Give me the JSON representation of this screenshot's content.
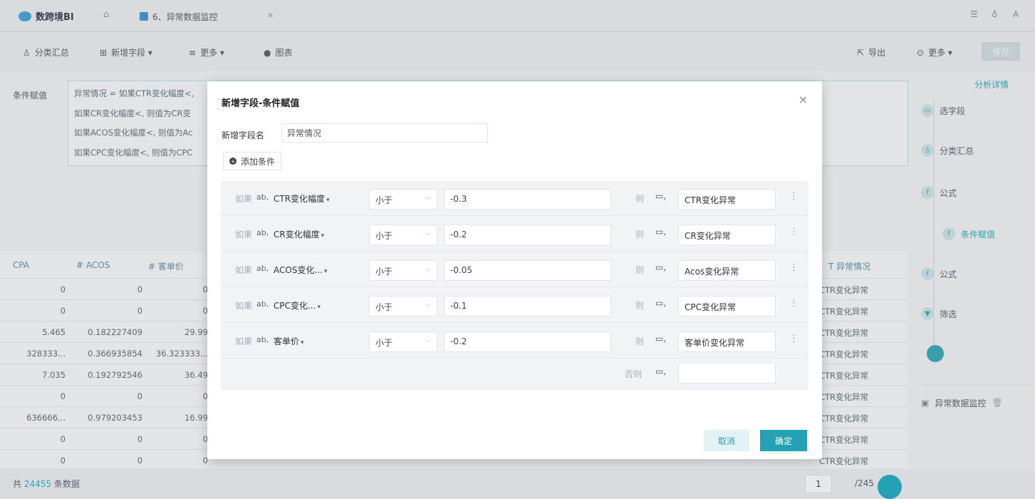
{
  "app": {
    "logo_text": "数跨境BI"
  },
  "tabs": [
    {
      "label": "6、异常数据监控"
    }
  ],
  "toolbar": {
    "items": [
      "分类汇总",
      "新增字段 ▾",
      "更多 ▾",
      "图表"
    ],
    "right_items": [
      "导出",
      "更多 ▾",
      "保存"
    ]
  },
  "background": {
    "cond_label": "条件赋值",
    "cond_lines": [
      "异常情况 = 如果CTR变化幅度<,",
      "如果CR变化幅度<, 则值为CR变",
      "如果ACOS变化幅度<, 则值为Ac",
      "如果CPC变化幅度<, 则值为CPC"
    ],
    "analysis_link": "分析详情",
    "table": {
      "headers": [
        "CPA",
        "# ACOS",
        "# 客单价",
        "T 异常情况"
      ],
      "rows": [
        [
          "0",
          "0",
          "0",
          "CTR变化异常"
        ],
        [
          "0",
          "0",
          "0",
          "CTR变化异常"
        ],
        [
          "5.465",
          "0.182227409",
          "29.99",
          "CTR变化异常"
        ],
        [
          "328333...",
          "0.366935854",
          "36.323333...",
          "CTR变化异常"
        ],
        [
          "7.035",
          "0.192792546",
          "36.49",
          "CTR变化异常"
        ],
        [
          "0",
          "0",
          "0",
          "CTR变化异常"
        ],
        [
          "636666...",
          "0.979203453",
          "16.99",
          "CTR变化异常"
        ],
        [
          "0",
          "0",
          "0",
          "CTR变化异常"
        ],
        [
          "0",
          "0",
          "0",
          "CTR变化异常"
        ]
      ]
    },
    "footer": {
      "prefix": "共",
      "count": "24455",
      "suffix": "条数据",
      "page": "1",
      "total": "/245"
    }
  },
  "right_panel": {
    "steps": [
      "选字段",
      "分类汇总",
      "公式",
      "条件赋值",
      "公式",
      "筛选"
    ],
    "dataset": "异常数据监控"
  },
  "modal": {
    "title": "新增字段-条件赋值",
    "field_label": "新增字段名",
    "field_value": "异常情况",
    "add_condition": "添加条件",
    "if_label": "如果",
    "then_label": "则",
    "else_label": "否则",
    "ab_label": "ab,",
    "conditions": [
      {
        "field": "CTR变化幅度",
        "op": "小于",
        "value": "-0.3",
        "result": "CTR变化异常"
      },
      {
        "field": "CR变化幅度",
        "op": "小于",
        "value": "-0.2",
        "result": "CR变化异常"
      },
      {
        "field": "ACOS变化...",
        "op": "小于",
        "value": "-0.05",
        "result": "Acos变化异常"
      },
      {
        "field": "CPC变化...",
        "op": "小于",
        "value": "-0.1",
        "result": "CPC变化异常"
      },
      {
        "field": "客单价",
        "op": "小于",
        "value": "-0.2",
        "result": "客单价变化异常"
      }
    ],
    "else_value": "",
    "cancel": "取消",
    "ok": "确定"
  },
  "colors": {
    "accent": "#24a1b3",
    "overlay": "#787d87"
  }
}
